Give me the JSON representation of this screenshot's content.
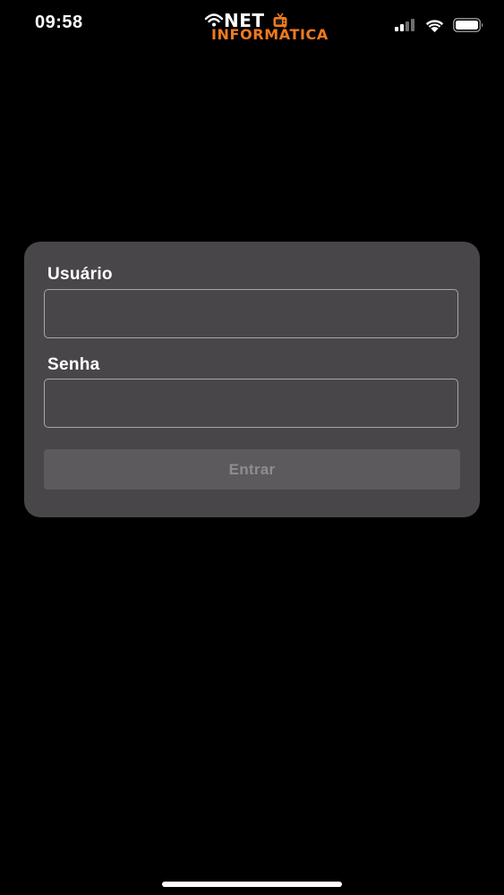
{
  "status_bar": {
    "time": "09:58",
    "icons": [
      "cellular-signal-icon",
      "wifi-icon",
      "battery-icon"
    ]
  },
  "logo": {
    "line1": "NET",
    "line2": "INFORMÁTICA",
    "colors": {
      "line1": "#ffffff",
      "line2": "#f07a1e"
    }
  },
  "login_form": {
    "username_label": "Usuário",
    "username_value": "",
    "password_label": "Senha",
    "password_value": "",
    "submit_label": "Entrar"
  },
  "colors": {
    "background": "#000000",
    "card": "#484649",
    "input_border": "#a8a6a9",
    "button_bg": "#5c5a5d",
    "button_text": "#8f8d90",
    "accent": "#f07a1e"
  }
}
